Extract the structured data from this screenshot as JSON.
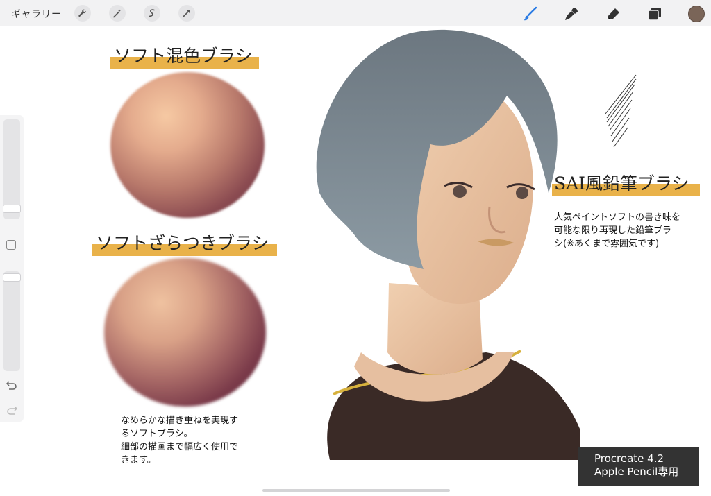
{
  "toolbar": {
    "gallery_label": "ギャラリー",
    "left_tools": [
      "wrench-icon",
      "magic-wand-icon",
      "selection-icon",
      "transform-icon"
    ],
    "right_tools": [
      "brush-icon",
      "smudge-icon",
      "eraser-icon",
      "layers-icon"
    ],
    "current_color": "#7a6558",
    "active_color": "#2a7be4"
  },
  "sidebar": {
    "size_slider_level": 0.93,
    "opacity_slider_level": 0.02
  },
  "canvas": {
    "headline1": "ソフト混色ブラシ",
    "headline2": "ソフトざらつきブラシ",
    "headline3": "SAI風鉛筆ブラシ",
    "desc1": "なめらかな描き重ねを実現す\nるソフトブラシ。\n細部の描画まで幅広く使用で\nきます。",
    "desc2": "人気ペイントソフトの書き味を\n可能な限り再現した鉛筆ブラ\nシ(※あくまで雰囲気です)",
    "badge_line1": "Procreate 4.2",
    "badge_line2": "Apple Pencil専用",
    "accent": "#e9b24a"
  }
}
